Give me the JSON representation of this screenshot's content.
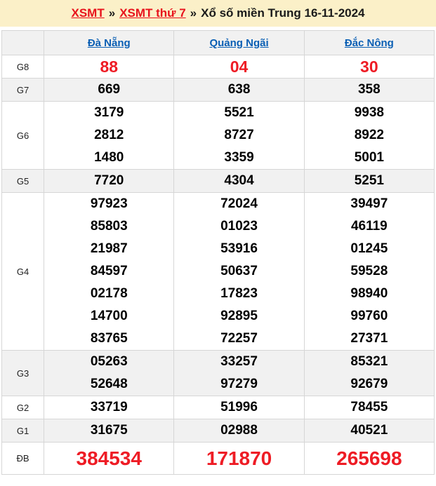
{
  "header": {
    "link1": "XSMT",
    "sep": "»",
    "link2": "XSMT thứ 7",
    "title": "Xổ số miền Trung 16-11-2024"
  },
  "colors": {
    "title_bar_bg": "#fbf0c8",
    "red_accent": "#ee1c25",
    "link_blue": "#0a5fb4",
    "zebra_gray": "#f1f1f1",
    "border_gray": "#d6d6d6"
  },
  "table": {
    "columns": [
      "Đà Nẵng",
      "Quảng Ngãi",
      "Đắc Nông"
    ],
    "rows": [
      {
        "label": "G8",
        "style": "red",
        "values": [
          [
            "88"
          ],
          [
            "04"
          ],
          [
            "30"
          ]
        ]
      },
      {
        "label": "G7",
        "style": "normal",
        "values": [
          [
            "669"
          ],
          [
            "638"
          ],
          [
            "358"
          ]
        ]
      },
      {
        "label": "G6",
        "style": "normal",
        "values": [
          [
            "3179",
            "2812",
            "1480"
          ],
          [
            "5521",
            "8727",
            "3359"
          ],
          [
            "9938",
            "8922",
            "5001"
          ]
        ]
      },
      {
        "label": "G5",
        "style": "normal",
        "values": [
          [
            "7720"
          ],
          [
            "4304"
          ],
          [
            "5251"
          ]
        ]
      },
      {
        "label": "G4",
        "style": "normal",
        "values": [
          [
            "97923",
            "85803",
            "21987",
            "84597",
            "02178",
            "14700",
            "83765"
          ],
          [
            "72024",
            "01023",
            "53916",
            "50637",
            "17823",
            "92895",
            "72257"
          ],
          [
            "39497",
            "46119",
            "01245",
            "59528",
            "98940",
            "99760",
            "27371"
          ]
        ]
      },
      {
        "label": "G3",
        "style": "normal",
        "values": [
          [
            "05263",
            "52648"
          ],
          [
            "33257",
            "97279"
          ],
          [
            "85321",
            "92679"
          ]
        ]
      },
      {
        "label": "G2",
        "style": "normal",
        "values": [
          [
            "33719"
          ],
          [
            "51996"
          ],
          [
            "78455"
          ]
        ]
      },
      {
        "label": "G1",
        "style": "normal",
        "values": [
          [
            "31675"
          ],
          [
            "02988"
          ],
          [
            "40521"
          ]
        ]
      },
      {
        "label": "ĐB",
        "style": "red-big",
        "values": [
          [
            "384534"
          ],
          [
            "171870"
          ],
          [
            "265698"
          ]
        ]
      }
    ]
  }
}
